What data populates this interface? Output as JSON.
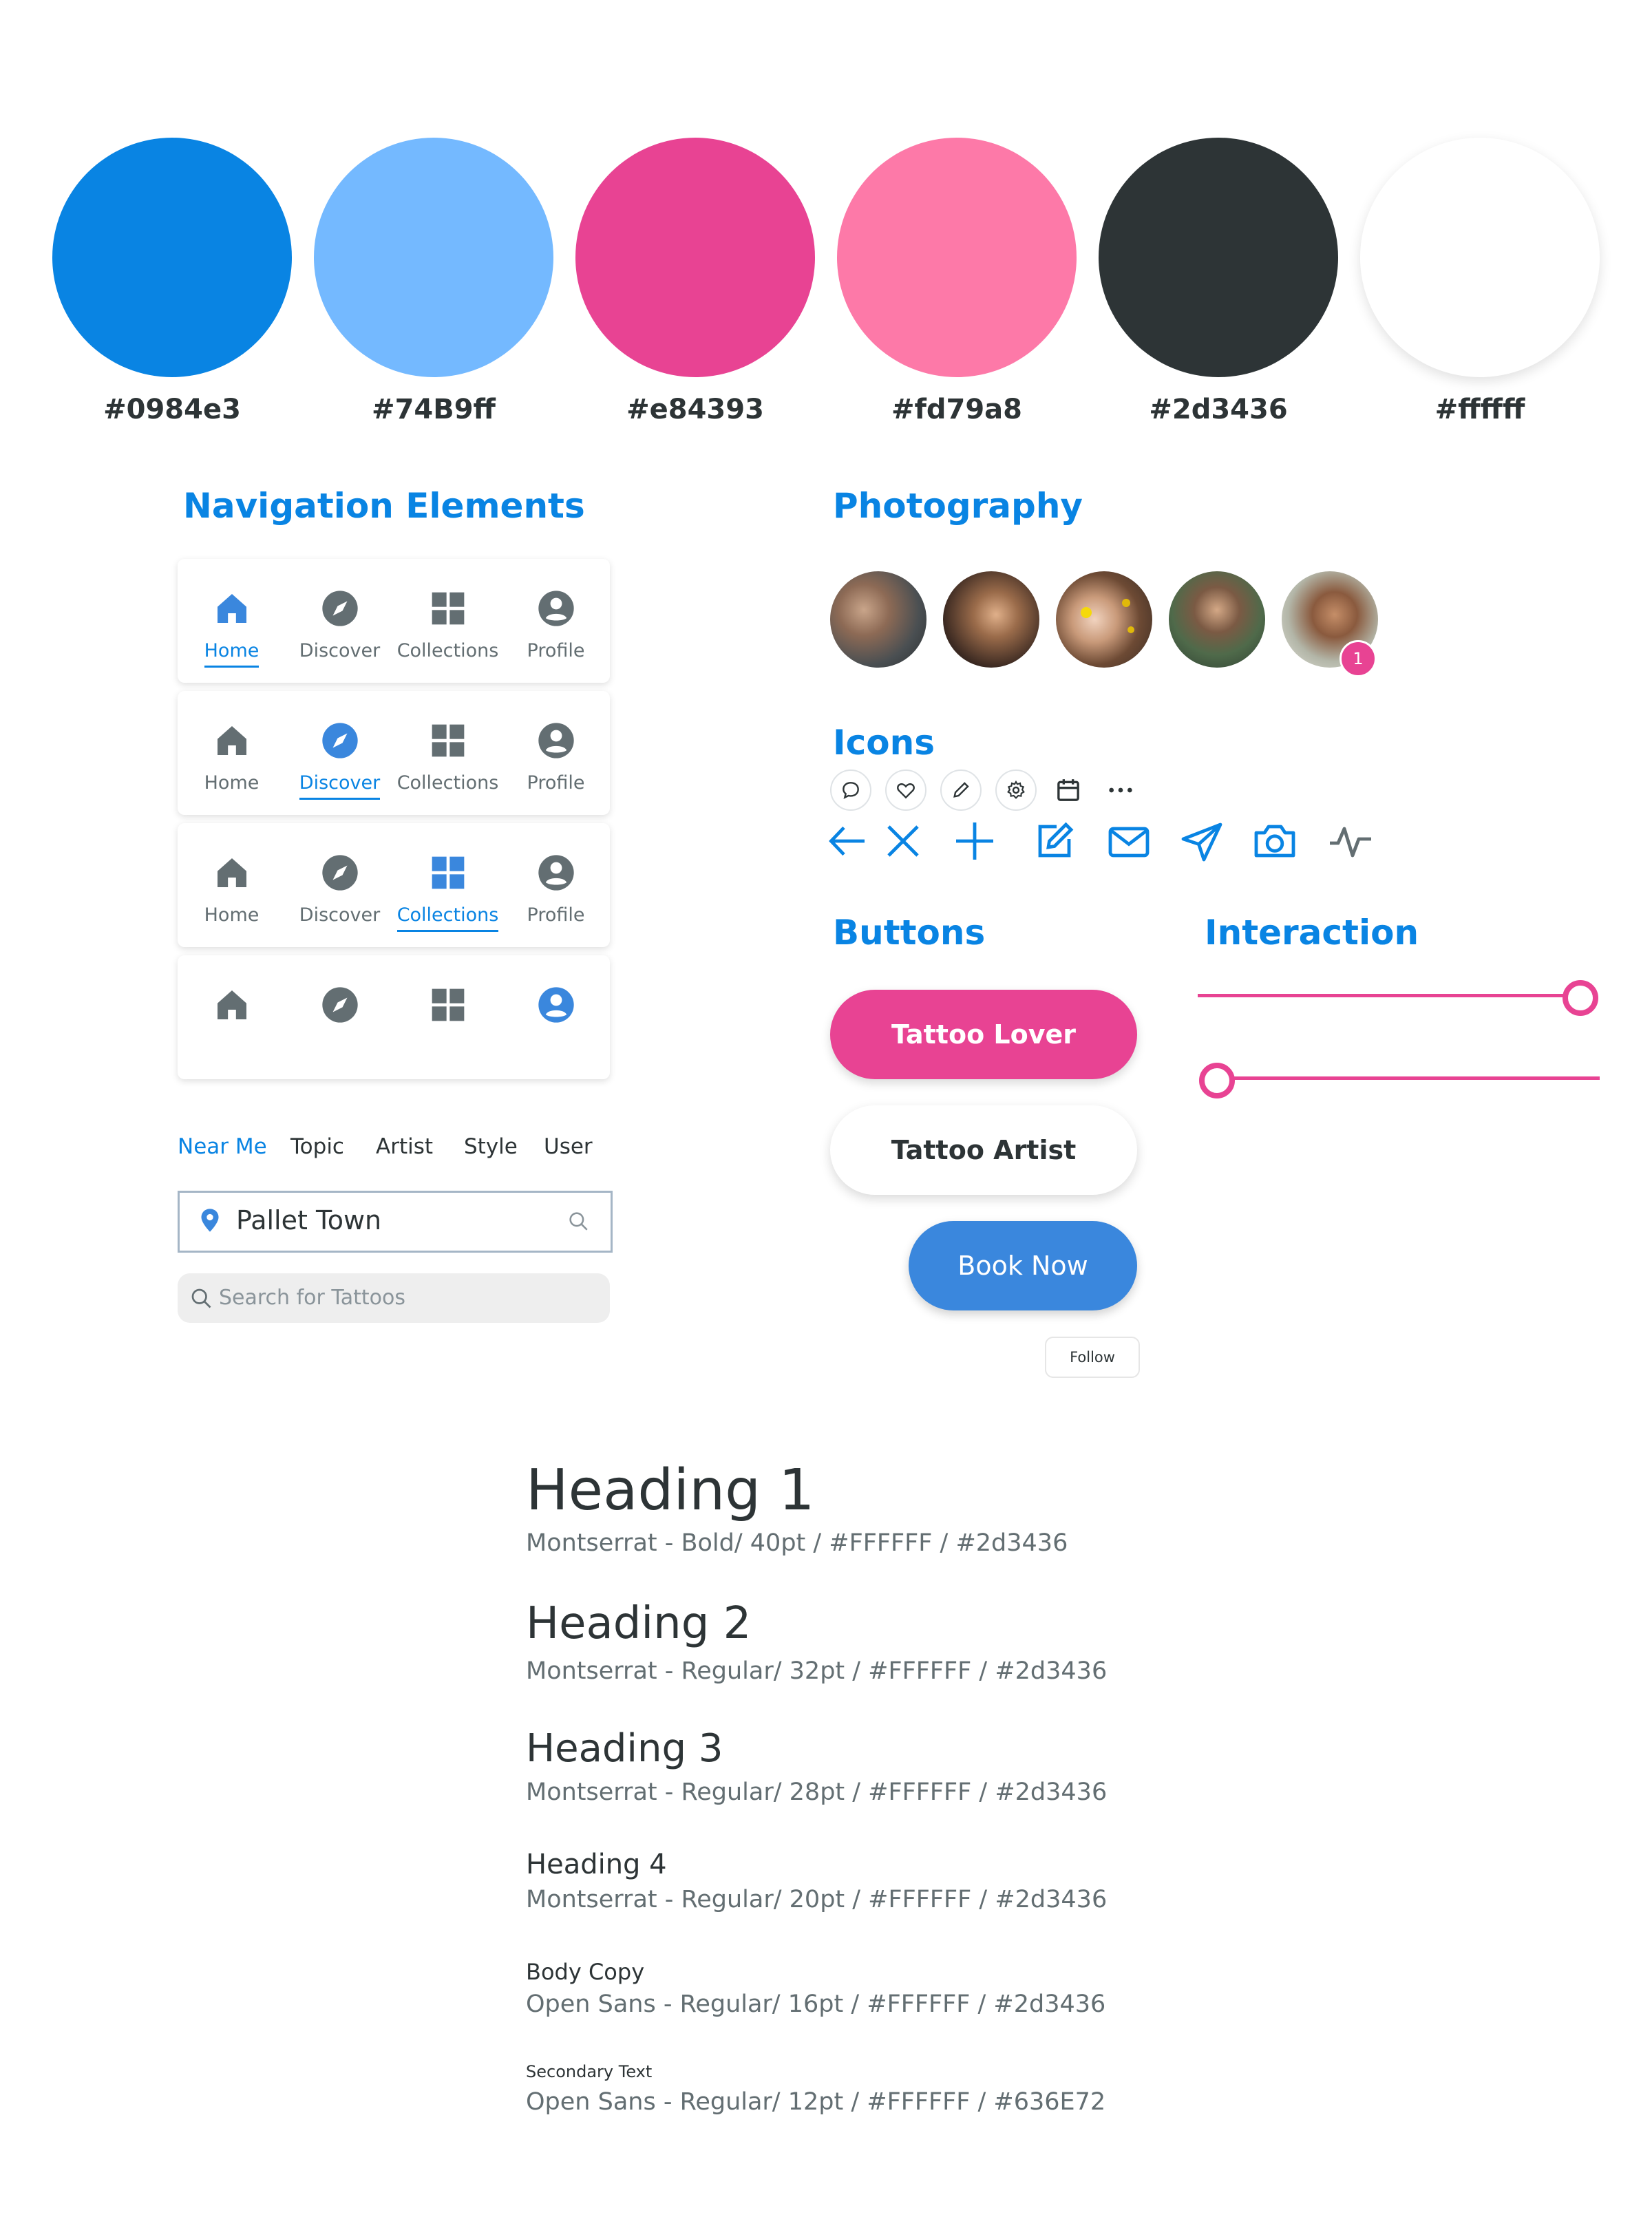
{
  "colors": {
    "accent_blue": "#0984e3",
    "light_blue": "#74B9ff",
    "pink": "#e84393",
    "light_pink": "#fd79a8",
    "dark": "#2d3436",
    "white": "#ffffff",
    "secondary": "#636e72",
    "button_blue": "#3a87dd"
  },
  "swatches": [
    {
      "label": "#0984e3",
      "color": "#0984e3"
    },
    {
      "label": "#74B9ff",
      "color": "#74B9ff"
    },
    {
      "label": "#e84393",
      "color": "#e84393"
    },
    {
      "label": "#fd79a8",
      "color": "#fd79a8"
    },
    {
      "label": "#2d3436",
      "color": "#2d3436"
    },
    {
      "label": "#ffffff",
      "color": "#ffffff"
    }
  ],
  "sections": {
    "navigation": "Navigation Elements",
    "photography": "Photography",
    "icons": "Icons",
    "buttons": "Buttons",
    "interaction": "Interaction"
  },
  "nav_bars": [
    {
      "active": "home",
      "labels": [
        "Home",
        "Discover",
        "Collections",
        "Profile"
      ]
    },
    {
      "active": "discover",
      "labels": [
        "Home",
        "Discover",
        "Collections",
        "Profile"
      ]
    },
    {
      "active": "collections",
      "labels": [
        "Home",
        "Discover",
        "Collections",
        "Profile"
      ]
    },
    {
      "active": "profile",
      "labels": []
    }
  ],
  "filter_tabs": [
    "Near Me",
    "Topic",
    "Artist",
    "Style",
    "User"
  ],
  "filter_active": "Near Me",
  "location_input": {
    "value": "Pallet Town"
  },
  "search_input": {
    "placeholder": "Search for Tattoos"
  },
  "photography": {
    "badge_count": "1"
  },
  "icons": {
    "small": [
      "chat-icon",
      "heart-icon",
      "pencil-icon",
      "gear-icon",
      "calendar-icon",
      "more-icon"
    ],
    "large": [
      "arrow-left-icon",
      "close-icon",
      "plus-icon",
      "edit-icon",
      "mail-icon",
      "send-icon",
      "camera-icon",
      "activity-icon"
    ]
  },
  "buttons": {
    "tattoo_lover": "Tattoo Lover",
    "tattoo_artist": "Tattoo Artist",
    "book_now": "Book Now",
    "follow": "Follow"
  },
  "sliders": [
    {
      "value": 1.0
    },
    {
      "value": 0.0
    }
  ],
  "typography": [
    {
      "name": "Heading 1",
      "spec": "Montserrat -  Bold/ 40pt / #FFFFFF / #2d3436"
    },
    {
      "name": "Heading 2",
      "spec": "Montserrat -  Regular/ 32pt / #FFFFFF / #2d3436"
    },
    {
      "name": "Heading 3",
      "spec": "Montserrat -  Regular/ 28pt / #FFFFFF / #2d3436"
    },
    {
      "name": "Heading 4",
      "spec": "Montserrat - Regular/ 20pt / #FFFFFF / #2d3436"
    },
    {
      "name": "Body Copy",
      "spec": "Open Sans -  Regular/ 16pt / #FFFFFF / #2d3436"
    },
    {
      "name": "Secondary Text",
      "spec": "Open Sans -  Regular/ 12pt / #FFFFFF / #636E72"
    }
  ]
}
